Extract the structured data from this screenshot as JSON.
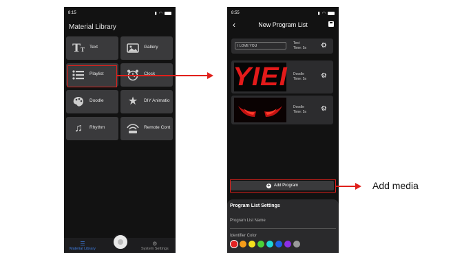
{
  "left_phone": {
    "status_time": "8:15",
    "title": "Material Library",
    "tiles": [
      {
        "label": "Text",
        "icon": "text-icon"
      },
      {
        "label": "Gallery",
        "icon": "gallery-icon"
      },
      {
        "label": "Playlist",
        "icon": "playlist-icon"
      },
      {
        "label": "Clock",
        "icon": "clock-icon"
      },
      {
        "label": "Doodle",
        "icon": "palette-icon"
      },
      {
        "label": "DIY Animatio",
        "icon": "sparkle-star-icon"
      },
      {
        "label": "Rhythm",
        "icon": "music-icon"
      },
      {
        "label": "Remote Cont",
        "icon": "wifi-remote-icon"
      }
    ],
    "tabs": [
      {
        "label": "Material Library",
        "icon": "list-icon",
        "active": true
      },
      {
        "label": "System Settings",
        "icon": "gear-icon",
        "active": false
      }
    ]
  },
  "right_phone": {
    "status_time": "8:55",
    "title": "New Program List",
    "programs": [
      {
        "text_value": "I LOVE YOU",
        "type": "Text",
        "time": "Time: 5s"
      },
      {
        "thumb_text": "YIEI",
        "type": "Doodle",
        "time": "Time: 5s"
      },
      {
        "thumb": "red-eyes-image",
        "type": "Doodle",
        "time": "Time: 5s"
      }
    ],
    "add_button": "Add Program",
    "settings": {
      "title": "Program List Settings",
      "name_placeholder": "Program List Name",
      "color_label": "Identifier Color",
      "colors": [
        "#e32222",
        "#f59c1a",
        "#f4e01e",
        "#4cd137",
        "#1ed6d6",
        "#1e60e6",
        "#8c2ee6",
        "#9a9a9a"
      ]
    }
  },
  "annotation": {
    "callout": "Add media",
    "accent": "#e0201b"
  }
}
